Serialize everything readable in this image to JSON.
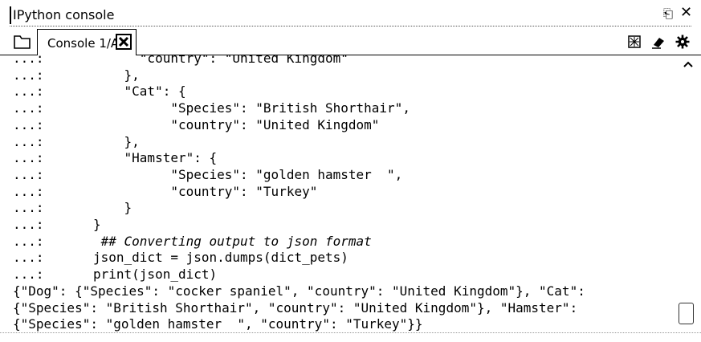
{
  "window": {
    "title": "IPython console"
  },
  "tabs": [
    {
      "label": "Console 1/A"
    }
  ],
  "icons": {
    "undock": "undock-icon",
    "close": "close-icon",
    "folder": "folder-icon",
    "tab_close": "tab-close-icon",
    "stop": "stop-kernel-icon",
    "clear": "eraser-icon",
    "options": "gear-icon"
  },
  "console": {
    "lines": [
      {
        "prompt": "...:",
        "text": "      \"country\": \"United Kingdom\""
      },
      {
        "prompt": "...:",
        "text": "    },"
      },
      {
        "prompt": "...:",
        "text": "    \"Cat\": {"
      },
      {
        "prompt": "...:",
        "text": "          \"Species\": \"British Shorthair\","
      },
      {
        "prompt": "...:",
        "text": "          \"country\": \"United Kingdom\""
      },
      {
        "prompt": "...:",
        "text": "    },"
      },
      {
        "prompt": "...:",
        "text": "    \"Hamster\": {"
      },
      {
        "prompt": "...:",
        "text": "          \"Species\": \"golden hamster  \","
      },
      {
        "prompt": "...:",
        "text": "          \"country\": \"Turkey\""
      },
      {
        "prompt": "...:",
        "text": "    }"
      },
      {
        "prompt": "...:",
        "text": "}"
      },
      {
        "prompt": "...:",
        "text": " ## Converting output to json format",
        "comment": true
      },
      {
        "prompt": "...:",
        "text": "json_dict = json.dumps(dict_pets)"
      },
      {
        "prompt": "...:",
        "text": "print(json_dict)"
      }
    ],
    "output": [
      "{\"Dog\": {\"Species\": \"cocker spaniel\", \"country\": \"United Kingdom\"}, \"Cat\":",
      "{\"Species\": \"British Shorthair\", \"country\": \"United Kingdom\"}, \"Hamster\":",
      "{\"Species\": \"golden hamster  \", \"country\": \"Turkey\"}}"
    ]
  }
}
